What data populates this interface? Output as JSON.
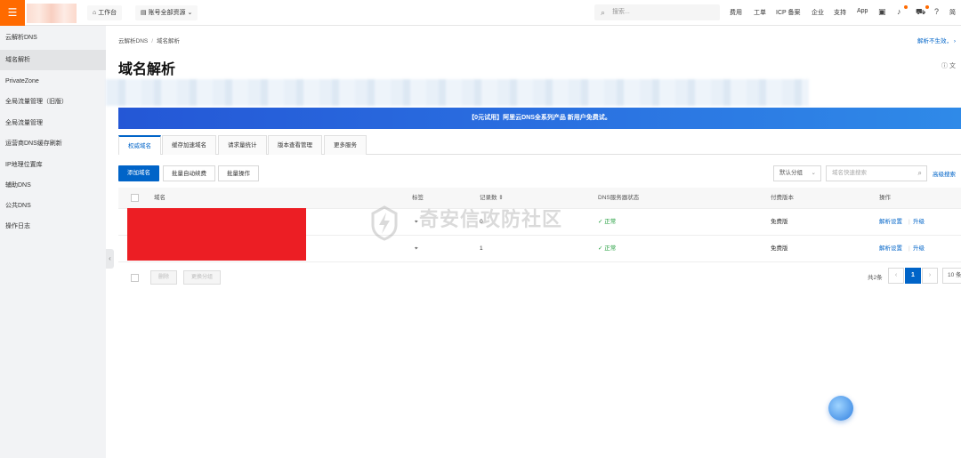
{
  "topbar": {
    "logo_glyph": "☰",
    "workbench": "工作台",
    "account": "账号全部资源",
    "search_placeholder": "搜索...",
    "nav": [
      "费用",
      "工单",
      "ICP 备案",
      "企业",
      "支持",
      "App"
    ]
  },
  "sidebar": {
    "items": [
      "云解析DNS",
      "域名解析",
      "PrivateZone",
      "全局流量管理（旧版）",
      "全局流量管理",
      "运营商DNS缓存刷新",
      "IP地理位置库",
      "辅助DNS",
      "公共DNS",
      "操作日志"
    ]
  },
  "breadcrumb": [
    "云解析DNS",
    "域名解析"
  ],
  "notice_link": "解析不生效，",
  "page_title": "域名解析",
  "banner_text": "【0元试用】阿里云DNS全系列产品 新用户免费试。",
  "tabs": [
    "权威域名",
    "缓存加速域名",
    "请求量统计",
    "版本查看管理",
    "更多服务"
  ],
  "toolbar": {
    "add": "添加域名",
    "batch_auto": "批量自动续费",
    "batch_ops": "批量操作",
    "group": "默认分组",
    "search_placeholder": "域名快速搜索",
    "advanced": "高级搜索"
  },
  "table": {
    "headers": [
      "域名",
      "标签",
      "记录数",
      "DNS服务器状态",
      "付费版本",
      "操作"
    ],
    "rows": [
      {
        "records": "0",
        "status": "正常",
        "version": "免费版",
        "action1": "解析设置",
        "action2": "升级"
      },
      {
        "records": "1",
        "status": "正常",
        "version": "免费版",
        "action1": "解析设置",
        "action2": "升级"
      }
    ]
  },
  "footer": {
    "delete": "删除",
    "change_group": "更换分组",
    "total": "共2条",
    "page": "1",
    "page_size": "10 条"
  },
  "watermark": "奇安信攻防社区",
  "colors": {
    "brand_orange": "#ff6a00",
    "primary_blue": "#0064c8",
    "redaction": "#ec1e24",
    "ok_green": "#1e9c3a"
  }
}
